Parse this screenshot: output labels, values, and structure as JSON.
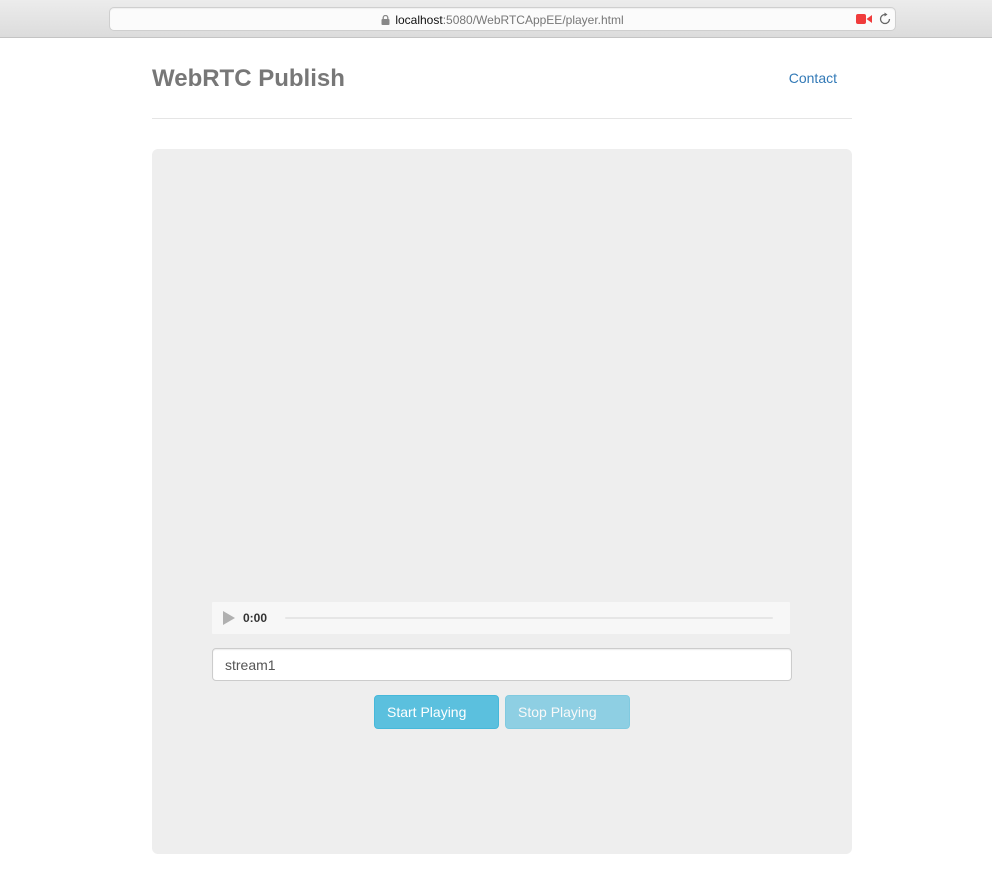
{
  "browser": {
    "url_host": "localhost",
    "url_rest": ":5080/WebRTCAppEE/player.html",
    "icons": [
      "lock-icon",
      "camera-icon",
      "reload-icon"
    ],
    "camera_icon_color": "#f03c3c"
  },
  "header": {
    "brand": "WebRTC Publish",
    "contact_label": "Contact"
  },
  "player": {
    "time": "0:00",
    "progress": 0
  },
  "stream_input": {
    "value": "stream1"
  },
  "buttons": {
    "start_label": "Start Playing",
    "stop_label": "Stop Playing"
  },
  "colors": {
    "brand_text": "#777777",
    "link": "#337ab7",
    "info_button": "#5bc0de",
    "jumbotron_bg": "#eeeeee"
  }
}
